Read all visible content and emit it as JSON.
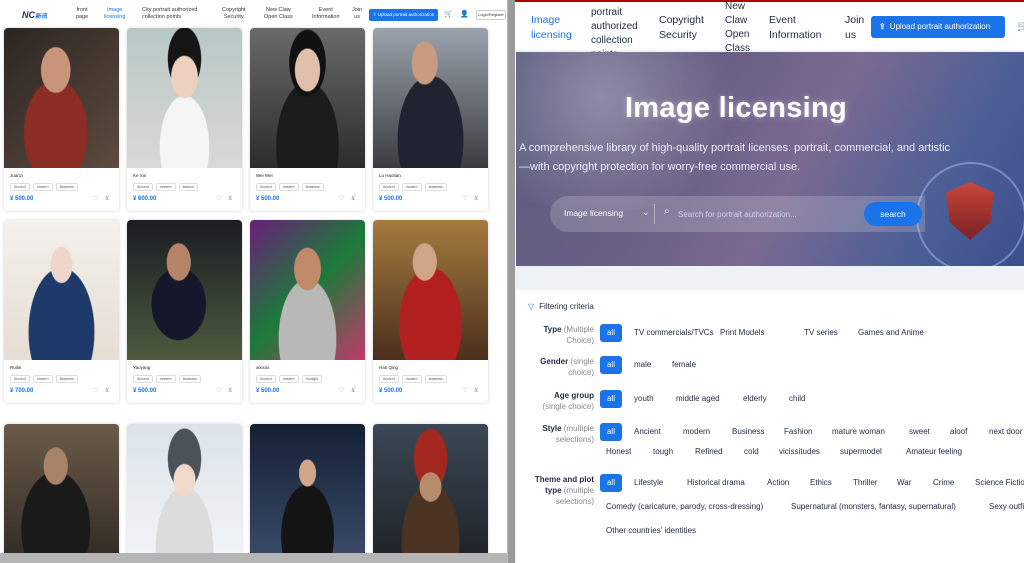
{
  "left_panel": {
    "logo": {
      "text": "NC",
      "sub": "新讯"
    },
    "nav": {
      "front_page": "front\npage",
      "image_licensing": "Image\nlicensing",
      "city_portrait": "City portrait authorized\ncollection points",
      "copyright": "Copyright\nSecurity",
      "new_claw": "New Claw\nOpen Class",
      "event": "Event\nInformation",
      "join": "Join\nus",
      "upload": "Upload portrait authorization",
      "login": "Login/Register"
    },
    "cards": [
      {
        "name": "Juanzi",
        "tags": [
          "Ancient",
          "modern",
          "Business"
        ],
        "price": "¥ 500.00"
      },
      {
        "name": "Ke Xin",
        "tags": [
          "Ancient",
          "modern",
          "fashion"
        ],
        "price": "¥ 600.00"
      },
      {
        "name": "Wei Wei",
        "tags": [
          "Ancient",
          "modern",
          "Business"
        ],
        "price": "¥ 500.00"
      },
      {
        "name": "Lu Haotian",
        "tags": [
          "Ancient",
          "modern",
          "Business"
        ],
        "price": "¥ 500.00"
      },
      {
        "name": "Ruilin",
        "tags": [
          "Ancient",
          "modern",
          "Business"
        ],
        "price": "¥ 700.00"
      },
      {
        "name": "Yaoyang",
        "tags": [
          "Ancient",
          "modern",
          "Business"
        ],
        "price": "¥ 500.00"
      },
      {
        "name": "xixixixi",
        "tags": [
          "Ancient",
          "modern",
          "Sunlight"
        ],
        "price": "¥ 500.00"
      },
      {
        "name": "Han Qing",
        "tags": [
          "Ancient",
          "modern",
          "Business"
        ],
        "price": "¥ 500.00"
      },
      {
        "name": "",
        "tags": [],
        "price": ""
      },
      {
        "name": "",
        "tags": [],
        "price": ""
      },
      {
        "name": "",
        "tags": [],
        "price": ""
      },
      {
        "name": "",
        "tags": [],
        "price": ""
      }
    ]
  },
  "right_panel": {
    "nav": {
      "image_licensing": "Image\nlicensing",
      "portrait": "portrait\nauthorized\ncollection\npoints",
      "copyright": "Copyright\nSecurity",
      "new_claw": "New\nClaw\nOpen\nClass",
      "event": "Event\nInformation",
      "join": "Join\nus",
      "upload": "Upload portrait authorization"
    },
    "hero": {
      "title": "Image licensing",
      "description": "A comprehensive library of high-quality portrait licenses: portrait, commercial, and artistic—with copyright protection for worry-free commercial use.",
      "search_category": "Image licensing",
      "search_placeholder": "Search for portrait authorization...",
      "search_button": "search"
    },
    "filter": {
      "heading": "Filtering criteria",
      "rows": [
        {
          "label": "Type",
          "sub": "(Multiple\nChoice)",
          "options": [
            "all",
            "TV commercials/TVCs",
            "Print Models",
            "TV series",
            "Games and Anime"
          ]
        },
        {
          "label": "Gender",
          "sub": "(single\nchoice)",
          "options": [
            "all",
            "male",
            "female"
          ]
        },
        {
          "label": "Age group",
          "sub": "(single choice)",
          "options": [
            "all",
            "youth",
            "middle aged",
            "elderly",
            "child"
          ]
        },
        {
          "label": "Style",
          "sub": "(multiple\nselections)",
          "options": [
            "all",
            "Ancient",
            "modern",
            "Business",
            "Fashion",
            "mature woman",
            "sweet",
            "aloof",
            "next door",
            "Honest",
            "tough",
            "Refined",
            "cold",
            "vicissitudes",
            "supermodel",
            "Amateur feeling"
          ]
        },
        {
          "label": "Theme and plot\ntype",
          "sub": "(multiple\nselections)",
          "options": [
            "all",
            "Lifestyle",
            "Historical drama",
            "Action",
            "Ethics",
            "Thriller",
            "War",
            "Crime",
            "Science Fiction",
            "Comedy (caricature, parody, cross-dressing)",
            "Supernatural (monsters, fantasy, supernatural)",
            "Sexy outfit",
            "Other countries' identities"
          ]
        }
      ]
    }
  }
}
